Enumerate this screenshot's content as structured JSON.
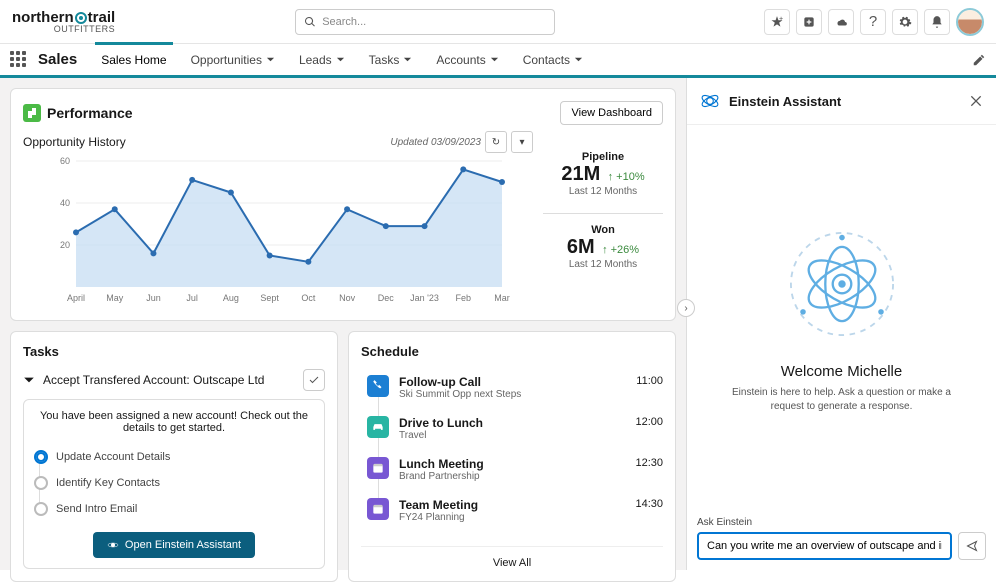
{
  "brand": {
    "line1a": "northern",
    "line1b": "trail",
    "line2": "OUTFITTERS"
  },
  "search": {
    "placeholder": "Search..."
  },
  "nav": {
    "app": "Sales",
    "tabs": [
      {
        "label": "Sales Home",
        "active": true,
        "dd": false
      },
      {
        "label": "Opportunities",
        "active": false,
        "dd": true
      },
      {
        "label": "Leads",
        "active": false,
        "dd": true
      },
      {
        "label": "Tasks",
        "active": false,
        "dd": true
      },
      {
        "label": "Accounts",
        "active": false,
        "dd": true
      },
      {
        "label": "Contacts",
        "active": false,
        "dd": true
      }
    ]
  },
  "performance": {
    "title": "Performance",
    "view_dash": "View Dashboard",
    "subtitle": "Opportunity History",
    "updated": "Updated 03/09/2023",
    "metrics": [
      {
        "label": "Pipeline",
        "value": "21M",
        "trend": "↑ +10%",
        "sub": "Last 12 Months"
      },
      {
        "label": "Won",
        "value": "6M",
        "trend": "↑ +26%",
        "sub": "Last 12 Months"
      }
    ]
  },
  "chart_data": {
    "type": "area",
    "title": "Opportunity History",
    "xlabel": "",
    "ylabel": "",
    "ylim": [
      0,
      60
    ],
    "yticks": [
      20,
      40,
      60
    ],
    "categories": [
      "April",
      "May",
      "Jun",
      "Jul",
      "Aug",
      "Sept",
      "Oct",
      "Nov",
      "Dec",
      "Jan '23",
      "Feb",
      "Mar"
    ],
    "values": [
      26,
      37,
      16,
      51,
      45,
      15,
      12,
      37,
      29,
      29,
      56,
      50
    ]
  },
  "tasks": {
    "title": "Tasks",
    "accordion": "Accept Transfered Account: Outscape Ltd",
    "lead": "You have been assigned a new account! Check out the details to get started.",
    "steps": [
      "Update Account Details",
      "Identify Key Contacts",
      "Send Intro Email"
    ],
    "cta": "Open Einstein Assistant"
  },
  "schedule": {
    "title": "Schedule",
    "items": [
      {
        "title": "Follow-up Call",
        "sub": "Ski Summit Opp next Steps",
        "time": "11:00",
        "color": "blue",
        "icon": "phone"
      },
      {
        "title": "Drive to Lunch",
        "sub": "Travel",
        "time": "12:00",
        "color": "teal",
        "icon": "car"
      },
      {
        "title": "Lunch Meeting",
        "sub": "Brand Partnership",
        "time": "12:30",
        "color": "purple",
        "icon": "calendar"
      },
      {
        "title": "Team Meeting",
        "sub": "FY24 Planning",
        "time": "14:30",
        "color": "purple",
        "icon": "calendar"
      }
    ],
    "view_all": "View All"
  },
  "einstein": {
    "title": "Einstein Assistant",
    "welcome": "Welcome Michelle",
    "sub": "Einstein is here to help. Ask a question or make a request to generate a response.",
    "ask_label": "Ask Einstein",
    "input_value": "Can you write me an overview of outscape and in"
  }
}
